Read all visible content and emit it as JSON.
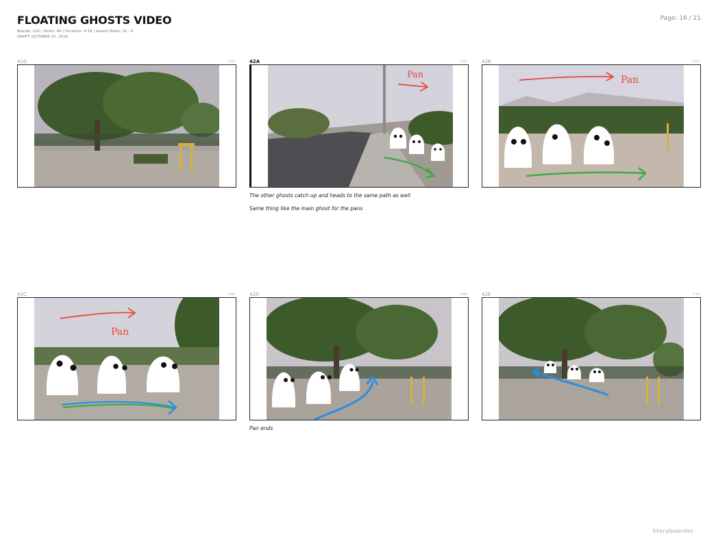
{
  "header": {
    "title": "FLOATING GHOSTS VIDEO",
    "stats": "Boards: 125  |  Shots: 46  |  Duration: 4:18  |  Aspect Ratio: 16 : 9",
    "draft": "DRAFT: OCTOBER 22, 2020",
    "page": "Page: 16 / 21"
  },
  "footer": {
    "brand": "Storyboarder"
  },
  "panels": [
    {
      "id": "41G",
      "duration": "3:00",
      "captions": [],
      "selected": false
    },
    {
      "id": "42A",
      "duration": "3:02",
      "selected": true,
      "captions": [
        "The other ghosts catch up and heads to the same path as well",
        "Same thing like the main ghost for the pans"
      ]
    },
    {
      "id": "42B",
      "duration": "3:04",
      "captions": [],
      "selected": false,
      "annotation": "Pan"
    },
    {
      "id": "42C",
      "duration": "3:06",
      "captions": [],
      "selected": false,
      "annotation": "Pan"
    },
    {
      "id": "42D",
      "duration": "3:08",
      "captions": [
        "Pan ends"
      ],
      "selected": false
    },
    {
      "id": "42E",
      "duration": "3:10",
      "captions": [],
      "selected": false
    }
  ],
  "colors": {
    "pan_arrow": "#e8463c",
    "path_green": "#3cab4a",
    "path_blue": "#2a8de0"
  }
}
